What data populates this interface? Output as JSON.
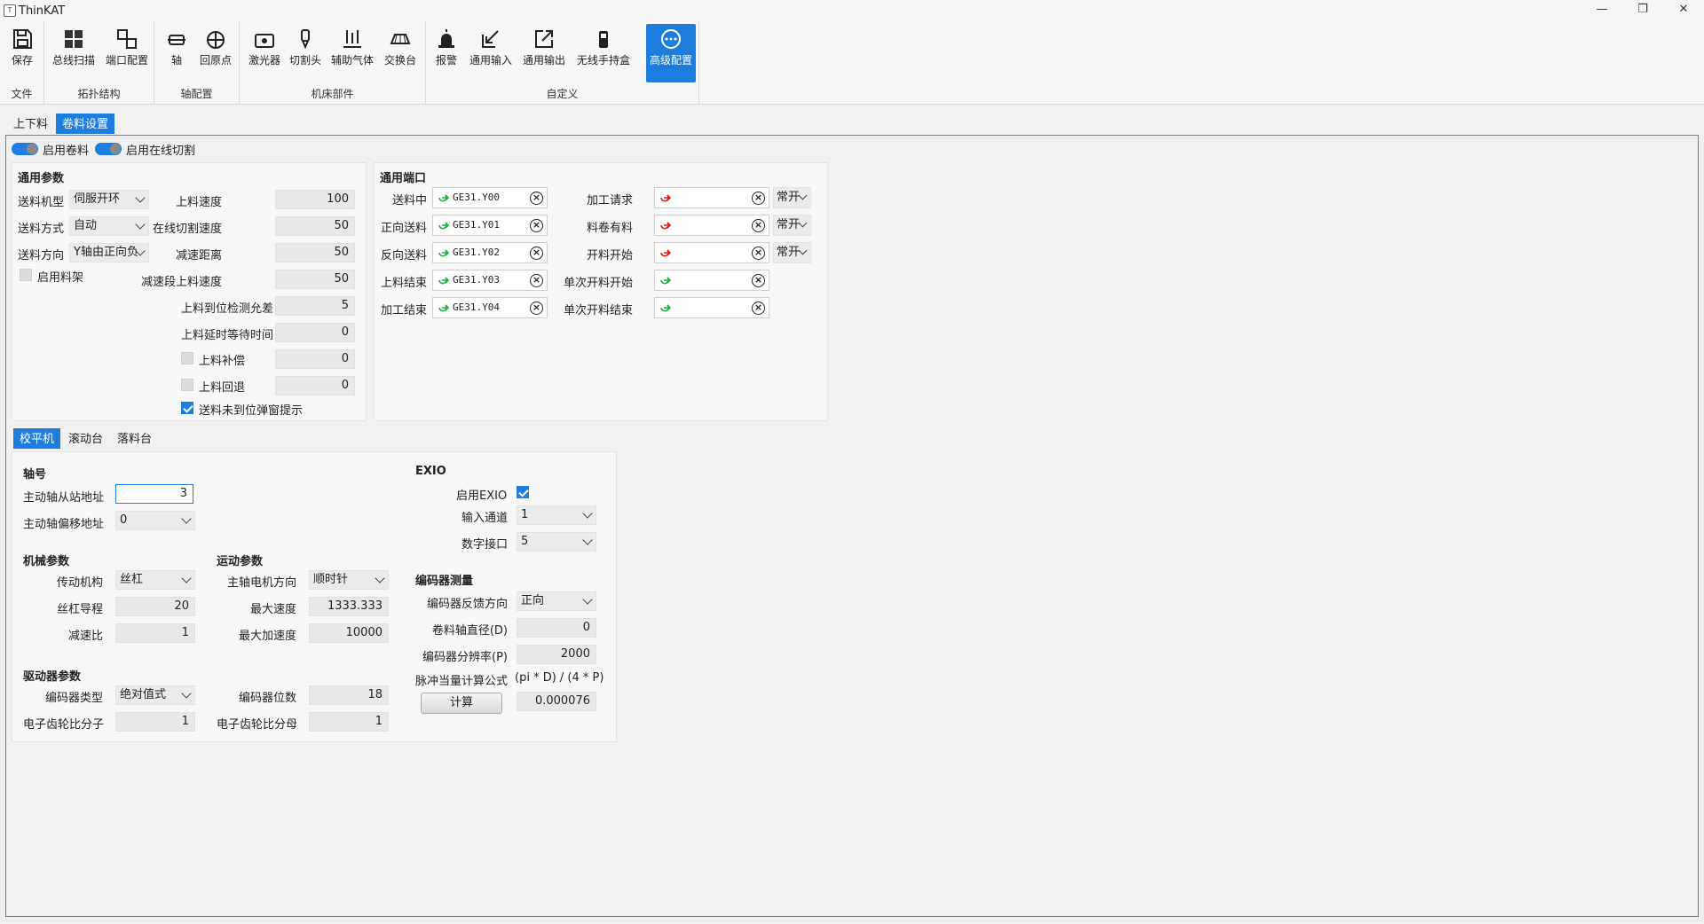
{
  "window": {
    "title": "ThinKAT",
    "min": "—",
    "restore": "❐",
    "close": "✕"
  },
  "ribbon": {
    "groups": [
      {
        "label": "文件"
      },
      {
        "label": "拓扑结构"
      },
      {
        "label": "轴配置"
      },
      {
        "label": "机床部件"
      },
      {
        "label": "自定义"
      }
    ],
    "buttons": [
      {
        "label": "保存",
        "icon": "save-icon"
      },
      {
        "label": "总线扫描",
        "icon": "bus-scan-icon"
      },
      {
        "label": "端口配置",
        "icon": "port-config-icon"
      },
      {
        "label": "轴",
        "icon": "axis-icon"
      },
      {
        "label": "回原点",
        "icon": "home-icon"
      },
      {
        "label": "激光器",
        "icon": "laser-icon"
      },
      {
        "label": "切割头",
        "icon": "cutting-head-icon"
      },
      {
        "label": "辅助气体",
        "icon": "gas-icon"
      },
      {
        "label": "交换台",
        "icon": "exchange-table-icon"
      },
      {
        "label": "报警",
        "icon": "alarm-icon"
      },
      {
        "label": "通用输入",
        "icon": "input-icon"
      },
      {
        "label": "通用输出",
        "icon": "output-icon"
      },
      {
        "label": "无线手持盒",
        "icon": "handheld-icon"
      },
      {
        "label": "高级配置",
        "icon": "advanced-icon"
      }
    ]
  },
  "tabs": {
    "loading": "上下料",
    "coil": "卷料设置"
  },
  "toggles": {
    "enable_coil": "启用卷料",
    "enable_online_cut": "启用在线切割"
  },
  "general": {
    "title": "通用参数",
    "feed_type_label": "送料机型",
    "feed_type": "伺服开环",
    "feed_mode_label": "送料方式",
    "feed_mode": "自动",
    "feed_dir_label": "送料方向",
    "feed_dir": "Y轴由正向负",
    "enable_rack": "启用料架",
    "load_speed_label": "上料速度",
    "load_speed": "100",
    "online_speed_label": "在线切割速度",
    "online_speed": "50",
    "decel_dist_label": "减速距离",
    "decel_dist": "50",
    "decel_speed_label": "减速段上料速度",
    "decel_speed": "50",
    "tol_label": "上料到位检测允差",
    "tol": "5",
    "delay_label": "上料延时等待时间",
    "delay": "0",
    "comp_label": "上料补偿",
    "comp": "0",
    "retract_label": "上料回退",
    "retract": "0",
    "popup_label": "送料未到位弹窗提示"
  },
  "ports": {
    "title": "通用端口",
    "left": [
      {
        "label": "送料中",
        "value": "GE31.Y00"
      },
      {
        "label": "正向送料",
        "value": "GE31.Y01"
      },
      {
        "label": "反向送料",
        "value": "GE31.Y02"
      },
      {
        "label": "上料结束",
        "value": "GE31.Y03"
      },
      {
        "label": "加工结束",
        "value": "GE31.Y04"
      }
    ],
    "right": [
      {
        "label": "加工请求",
        "value": "",
        "mode": "常开"
      },
      {
        "label": "料卷有料",
        "value": "",
        "mode": "常开"
      },
      {
        "label": "开料开始",
        "value": "",
        "mode": "常开"
      },
      {
        "label": "单次开料开始",
        "value": ""
      },
      {
        "label": "单次开料结束",
        "value": ""
      }
    ]
  },
  "subtabs": {
    "leveler": "校平机",
    "roller": "滚动台",
    "unload": "落料台"
  },
  "axis": {
    "title": "轴号",
    "slave_label": "主动轴从站地址",
    "slave": "3",
    "offset_label": "主动轴偏移地址",
    "offset": "0"
  },
  "mech": {
    "title": "机械参数",
    "trans_label": "传动机构",
    "trans": "丝杠",
    "lead_label": "丝杠导程",
    "lead": "20",
    "ratio_label": "减速比",
    "ratio": "1"
  },
  "motion": {
    "title": "运动参数",
    "dir_label": "主轴电机方向",
    "dir": "顺时针",
    "vmax_label": "最大速度",
    "vmax": "1333.333",
    "amax_label": "最大加速度",
    "amax": "10000"
  },
  "driver": {
    "title": "驱动器参数",
    "enc_type_label": "编码器类型",
    "enc_type": "绝对值式",
    "enc_bits_label": "编码器位数",
    "enc_bits": "18",
    "num_label": "电子齿轮比分子",
    "num": "1",
    "den_label": "电子齿轮比分母",
    "den": "1"
  },
  "exio": {
    "title": "EXIO",
    "enable_label": "启用EXIO",
    "channel_label": "输入通道",
    "channel": "1",
    "port_label": "数字接口",
    "port": "5"
  },
  "encoder": {
    "title": "编码器测量",
    "dir_label": "编码器反馈方向",
    "dir": "正向",
    "diam_label": "卷料轴直径(D)",
    "diam": "0",
    "res_label": "编码器分辨率(P)",
    "res": "2000",
    "formula_label": "脉冲当量计算公式",
    "formula": "(pi * D) / (4 * P)",
    "calc": "计算",
    "result": "0.000076"
  }
}
